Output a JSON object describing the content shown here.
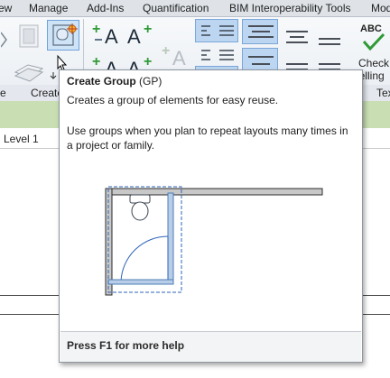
{
  "ribbon": {
    "tabs": [
      "ew",
      "Manage",
      "Add-Ins",
      "Quantification",
      "BIM Interoperability Tools",
      "Mod"
    ],
    "panel_labels": {
      "left_partial": "e",
      "create": "Create",
      "text_partial": "Tex"
    },
    "check_spelling": {
      "line1": "Check",
      "line2": "pelling",
      "icon_text": "ABC"
    }
  },
  "view": {
    "level_label": "Level 1"
  },
  "tooltip": {
    "title": "Create Group",
    "shortcut": "(GP)",
    "description": "Creates a group of elements for easy reuse.",
    "detail": "Use groups when you plan to repeat layouts many times in a project or family.",
    "footer": "Press F1 for more help"
  },
  "colors": {
    "ribbon_bottom": "#c9dfb3",
    "selection_blue": "#6ea2d8",
    "wall_gray": "#c8c8c8"
  }
}
